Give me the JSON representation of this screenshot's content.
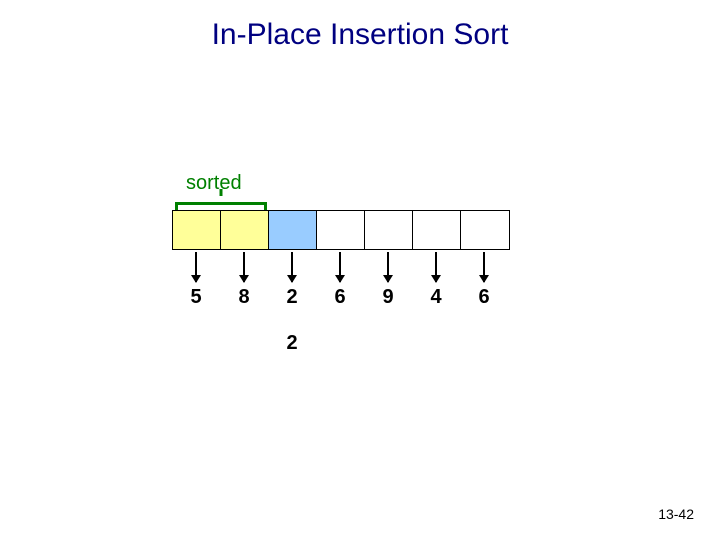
{
  "title": "In-Place Insertion Sort",
  "sorted_label": "sorted",
  "cells": [
    {
      "color": "yellow",
      "value": "5"
    },
    {
      "color": "yellow",
      "value": "8"
    },
    {
      "color": "blue",
      "value": "2"
    },
    {
      "color": "white",
      "value": "6"
    },
    {
      "color": "white",
      "value": "9"
    },
    {
      "color": "white",
      "value": "4"
    },
    {
      "color": "white",
      "value": "6"
    }
  ],
  "extra_value": "2",
  "slide_number": "13-42"
}
